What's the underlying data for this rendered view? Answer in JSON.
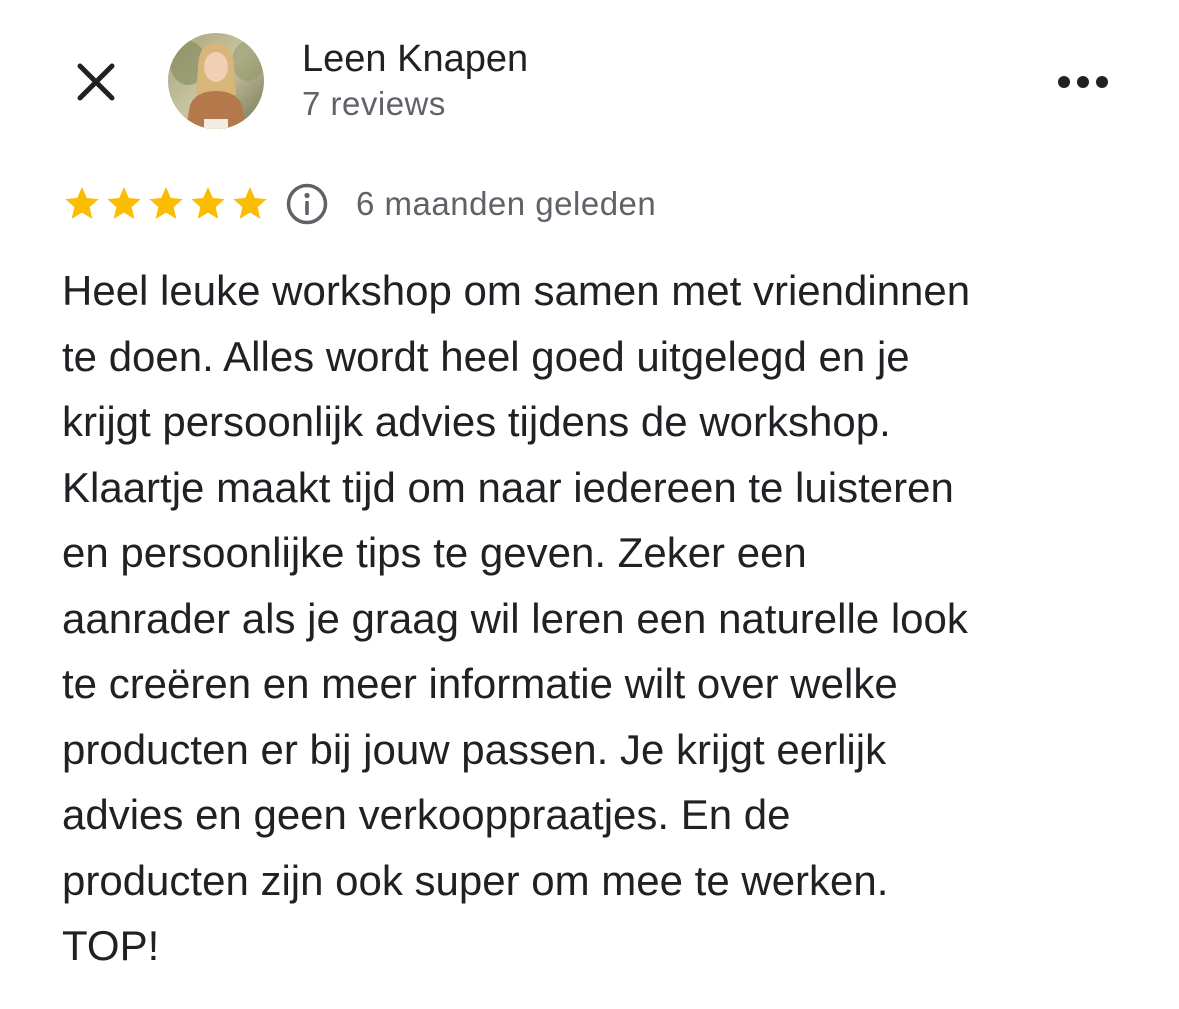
{
  "header": {
    "reviewer_name": "Leen Knapen",
    "review_count": "7 reviews"
  },
  "review": {
    "rating": 5,
    "max_rating": 5,
    "time_ago": "6 maanden geleden",
    "text": "Heel leuke workshop om samen met vriendinnen\nte doen. Alles wordt heel goed uitgelegd en je\nkrijgt persoonlijk advies tijdens de workshop.\nKlaartje maakt tijd om naar iedereen te luisteren\nen persoonlijke tips te geven. Zeker een\naanrader als je graag wil leren een naturelle look\nte creëren en meer informatie wilt over welke\nproducten er bij jouw passen. Je krijgt eerlijk\nadvies en geen verkooppraatjes. En de\nproducten zijn ook super om mee te werken.\nTOP!"
  },
  "icons": {
    "close": "close-icon",
    "avatar": "avatar-photo",
    "more": "more-horizontal-icon",
    "star": "star-icon",
    "info": "info-icon"
  },
  "colors": {
    "star": "#fbbc04",
    "primary_text": "#202124",
    "secondary_text": "#5f6368",
    "background": "#ffffff"
  }
}
